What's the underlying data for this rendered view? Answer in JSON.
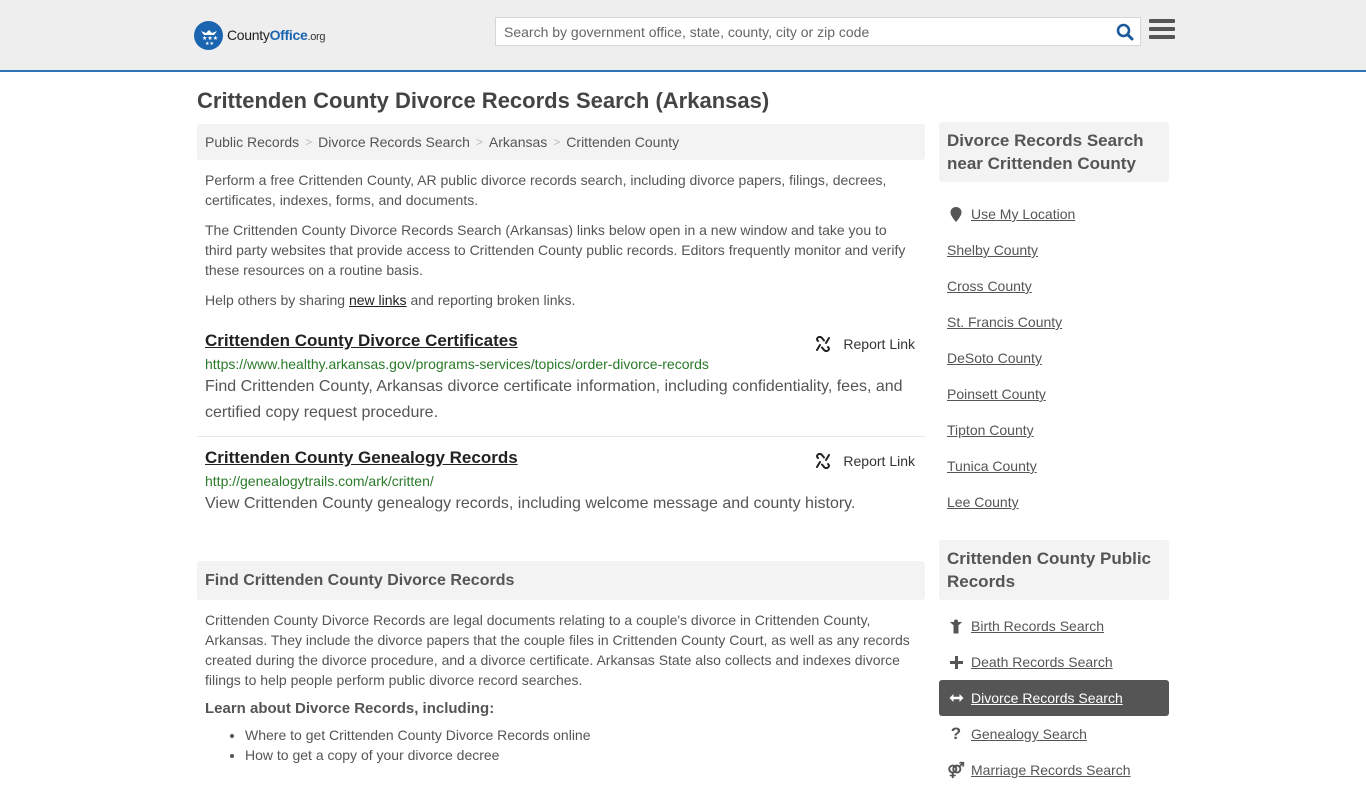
{
  "header": {
    "logo": {
      "county": "County",
      "office": "Office",
      "tld": ".org"
    },
    "search_placeholder": "Search by government office, state, county, city or zip code",
    "search_value": ""
  },
  "page_title": "Crittenden County Divorce Records Search (Arkansas)",
  "breadcrumb": [
    "Public Records",
    "Divorce Records Search",
    "Arkansas",
    "Crittenden County"
  ],
  "intro": {
    "p1": "Perform a free Crittenden County, AR public divorce records search, including divorce papers, filings, decrees, certificates, indexes, forms, and documents.",
    "p2": "The Crittenden County Divorce Records Search (Arkansas) links below open in a new window and take you to third party websites that provide access to Crittenden County public records. Editors frequently monitor and verify these resources on a routine basis.",
    "p3_before": "Help others by sharing ",
    "p3_link": "new links",
    "p3_after": " and reporting broken links."
  },
  "links": [
    {
      "title": "Crittenden County Divorce Certificates",
      "url": "https://www.healthy.arkansas.gov/programs-services/topics/order-divorce-records",
      "description": "Find Crittenden County, Arkansas divorce certificate information, including confidentiality, fees, and certified copy request procedure.",
      "report_label": "Report Link"
    },
    {
      "title": "Crittenden County Genealogy Records",
      "url": "http://genealogytrails.com/ark/critten/",
      "description": "View Crittenden County genealogy records, including welcome message and county history.",
      "report_label": "Report Link"
    }
  ],
  "find_section": {
    "heading": "Find Crittenden County Divorce Records",
    "body": "Crittenden County Divorce Records are legal documents relating to a couple's divorce in Crittenden County, Arkansas. They include the divorce papers that the couple files in Crittenden County Court, as well as any records created during the divorce procedure, and a divorce certificate. Arkansas State also collects and indexes divorce filings to help people perform public divorce record searches.",
    "learn_heading": "Learn about Divorce Records, including:",
    "learn_items": [
      "Where to get Crittenden County Divorce Records online",
      "How to get a copy of your divorce decree"
    ]
  },
  "sidebar": {
    "nearby": {
      "heading": "Divorce Records Search near Crittenden County",
      "use_location": "Use My Location",
      "items": [
        "Shelby County",
        "Cross County",
        "St. Francis County",
        "DeSoto County",
        "Poinsett County",
        "Tipton County",
        "Tunica County",
        "Lee County"
      ]
    },
    "public_records": {
      "heading": "Crittenden County Public Records",
      "items": [
        {
          "label": "Birth Records Search",
          "icon": "child-icon",
          "glyph": "Ὣ8",
          "active": false
        },
        {
          "label": "Death Records Search",
          "icon": "plus-icon",
          "glyph": "+",
          "active": false
        },
        {
          "label": "Divorce Records Search",
          "icon": "arrows-horizontal-icon",
          "glyph": "↔",
          "active": true
        },
        {
          "label": "Genealogy Search",
          "icon": "question-icon",
          "glyph": "?",
          "active": false
        },
        {
          "label": "Marriage Records Search",
          "icon": "marriage-icon",
          "glyph": "⚥",
          "active": false
        }
      ]
    }
  },
  "colors": {
    "brand_blue": "#1a64b0",
    "header_border": "#2f75b5",
    "url_green": "#2a7a2a",
    "active_bg": "#555555"
  }
}
